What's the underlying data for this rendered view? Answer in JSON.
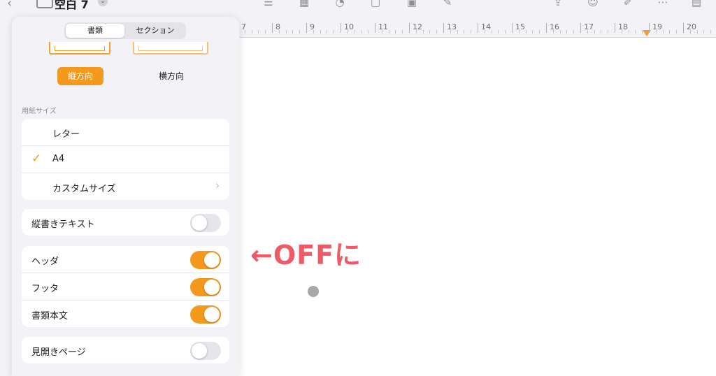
{
  "toolbar": {
    "title": "空白 7",
    "icons": [
      "back-icon",
      "sidebar-icon",
      "list-icon",
      "table-icon",
      "chart-icon",
      "shape-icon",
      "media-icon",
      "pen-icon",
      "share-icon",
      "collaborate-icon",
      "format-brush-icon",
      "more-icon",
      "reader-icon"
    ]
  },
  "ruler": {
    "numbers": [
      "7",
      "8",
      "9",
      "10",
      "11",
      "12",
      "13",
      "14",
      "15",
      "16",
      "17",
      "18",
      "19",
      "20"
    ],
    "marker_color": "#f0a030"
  },
  "panel": {
    "segments": {
      "active": "書類",
      "inactive": "セクション"
    },
    "orientation": {
      "portrait": "縦方向",
      "landscape": "横方向",
      "selected": "portrait"
    },
    "paper_size_label": "用紙サイズ",
    "paper_sizes": [
      {
        "label": "レター",
        "selected": false
      },
      {
        "label": "A4",
        "selected": true
      },
      {
        "label": "カスタムサイズ",
        "has_chevron": true
      }
    ],
    "vertical_text": {
      "label": "縦書きテキスト",
      "on": false
    },
    "toggles": [
      {
        "label": "ヘッダ",
        "on": true
      },
      {
        "label": "フッタ",
        "on": true
      },
      {
        "label": "書類本文",
        "on": true
      }
    ],
    "facing_pages": {
      "label": "見開きページ",
      "on": false
    }
  },
  "annotation": {
    "text": "←OFFに",
    "color": "#ee5a66"
  },
  "colors": {
    "accent": "#f39a1e",
    "background": "#f2f2f7",
    "document": "#ffffff"
  }
}
